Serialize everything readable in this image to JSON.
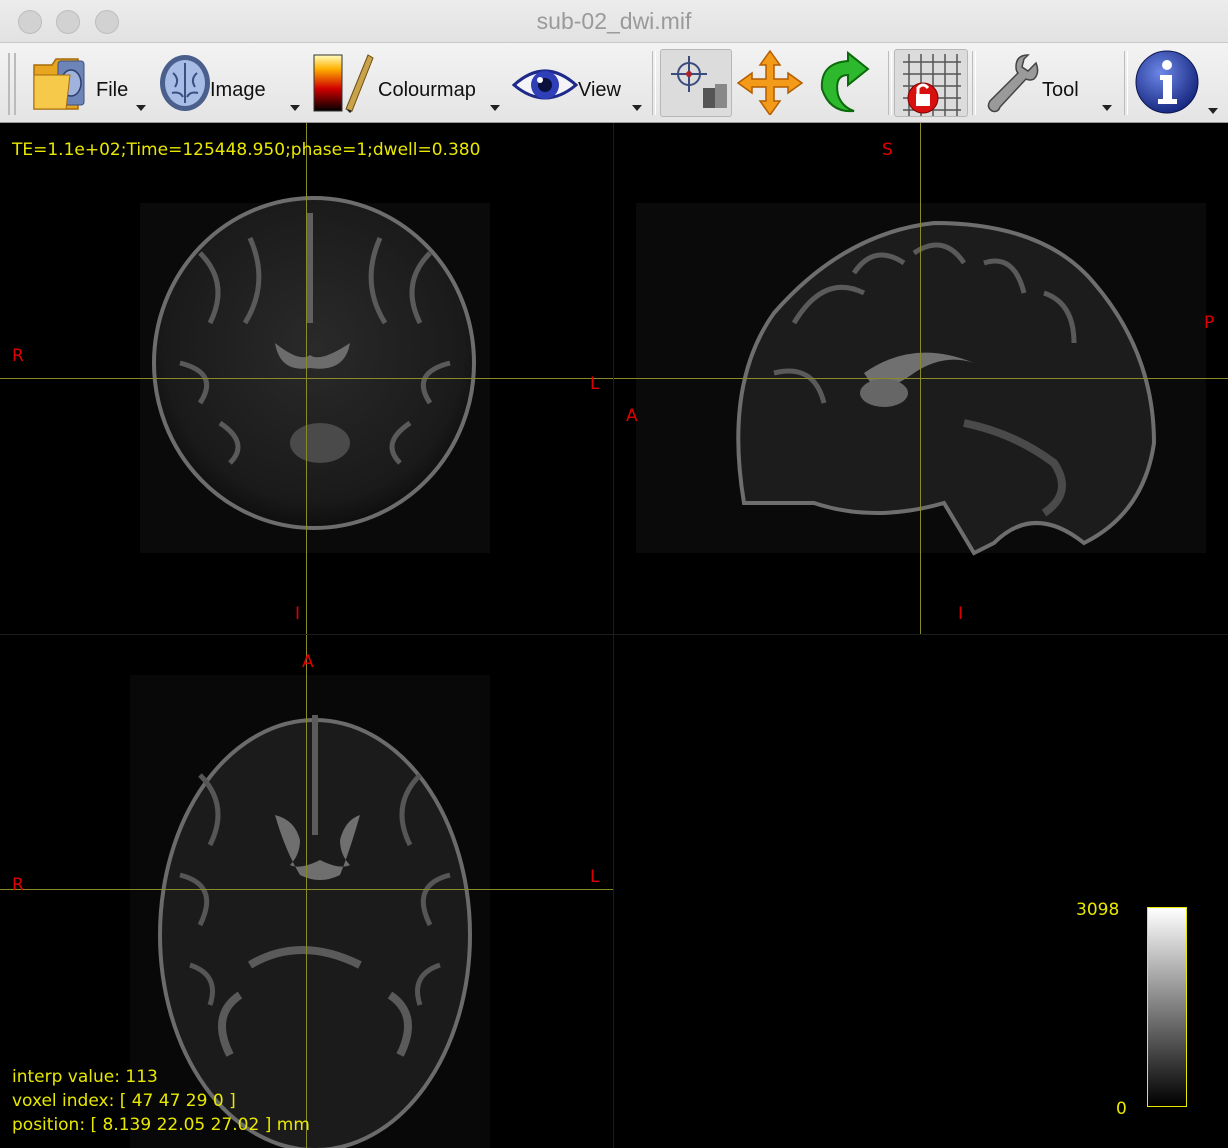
{
  "window": {
    "title": "sub-02_dwi.mif"
  },
  "toolbar": {
    "file_label": "File",
    "image_label": "Image",
    "colourmap_label": "Colourmap",
    "view_label": "View",
    "tool_label": "Tool",
    "icons": [
      "folder-icon",
      "brain-icon",
      "colourbar-icon",
      "eye-icon",
      "crosshair-mode-icon",
      "pan-mode-icon",
      "rotate-mode-icon",
      "lock-grid-icon",
      "wrench-icon",
      "info-icon"
    ]
  },
  "viewer": {
    "header_info": "TE=1.1e+02;Time=125448.950;phase=1;dwell=0.380",
    "coronal": {
      "left": "R",
      "right": "L",
      "bottom": "I"
    },
    "sagittal": {
      "top": "S",
      "left": "A",
      "right": "P",
      "bottom": "I"
    },
    "axial": {
      "top": "A",
      "left": "R",
      "right": "L"
    },
    "status": {
      "interp_value": "interp value: 113",
      "voxel_index": "voxel index: [ 47 47 29 0 ]",
      "position": "position: [ 8.139 22.05 27.02 ] mm"
    },
    "colourbar": {
      "max_label": "3098",
      "min_label": "0"
    },
    "colors": {
      "crosshair": "#8a8a2a",
      "orientation": "#e00000",
      "overlay_text": "#e8e800"
    }
  }
}
